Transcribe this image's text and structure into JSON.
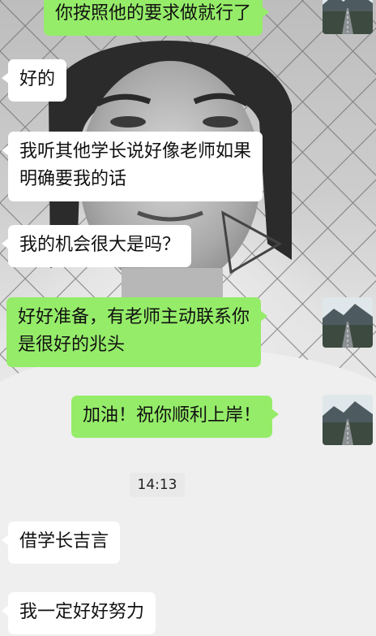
{
  "chat": {
    "messages": [
      {
        "side": "out",
        "lines": [
          "你按照他的要求做就行了"
        ]
      },
      {
        "side": "in",
        "lines": [
          "好的"
        ]
      },
      {
        "side": "in",
        "lines": [
          "我听其他学长说好像老师如果",
          "明确要我的话"
        ]
      },
      {
        "side": "in",
        "lines": [
          "我的机会很大是吗？"
        ]
      },
      {
        "side": "out",
        "lines": [
          "好好准备，有老师主动联系你",
          "是很好的兆头"
        ]
      },
      {
        "side": "out",
        "lines": [
          "加油！祝你顺利上岸！"
        ]
      },
      {
        "side": "in",
        "lines": [
          "借学长吉言"
        ]
      },
      {
        "side": "in",
        "lines": [
          "我一定好好努力"
        ]
      }
    ],
    "timestamp": "14:13"
  },
  "avatar": {
    "icon": "road-landscape-avatar-icon"
  },
  "colors": {
    "outgoing_bubble": "#95ec69",
    "incoming_bubble": "#ffffff",
    "text": "#111111"
  }
}
